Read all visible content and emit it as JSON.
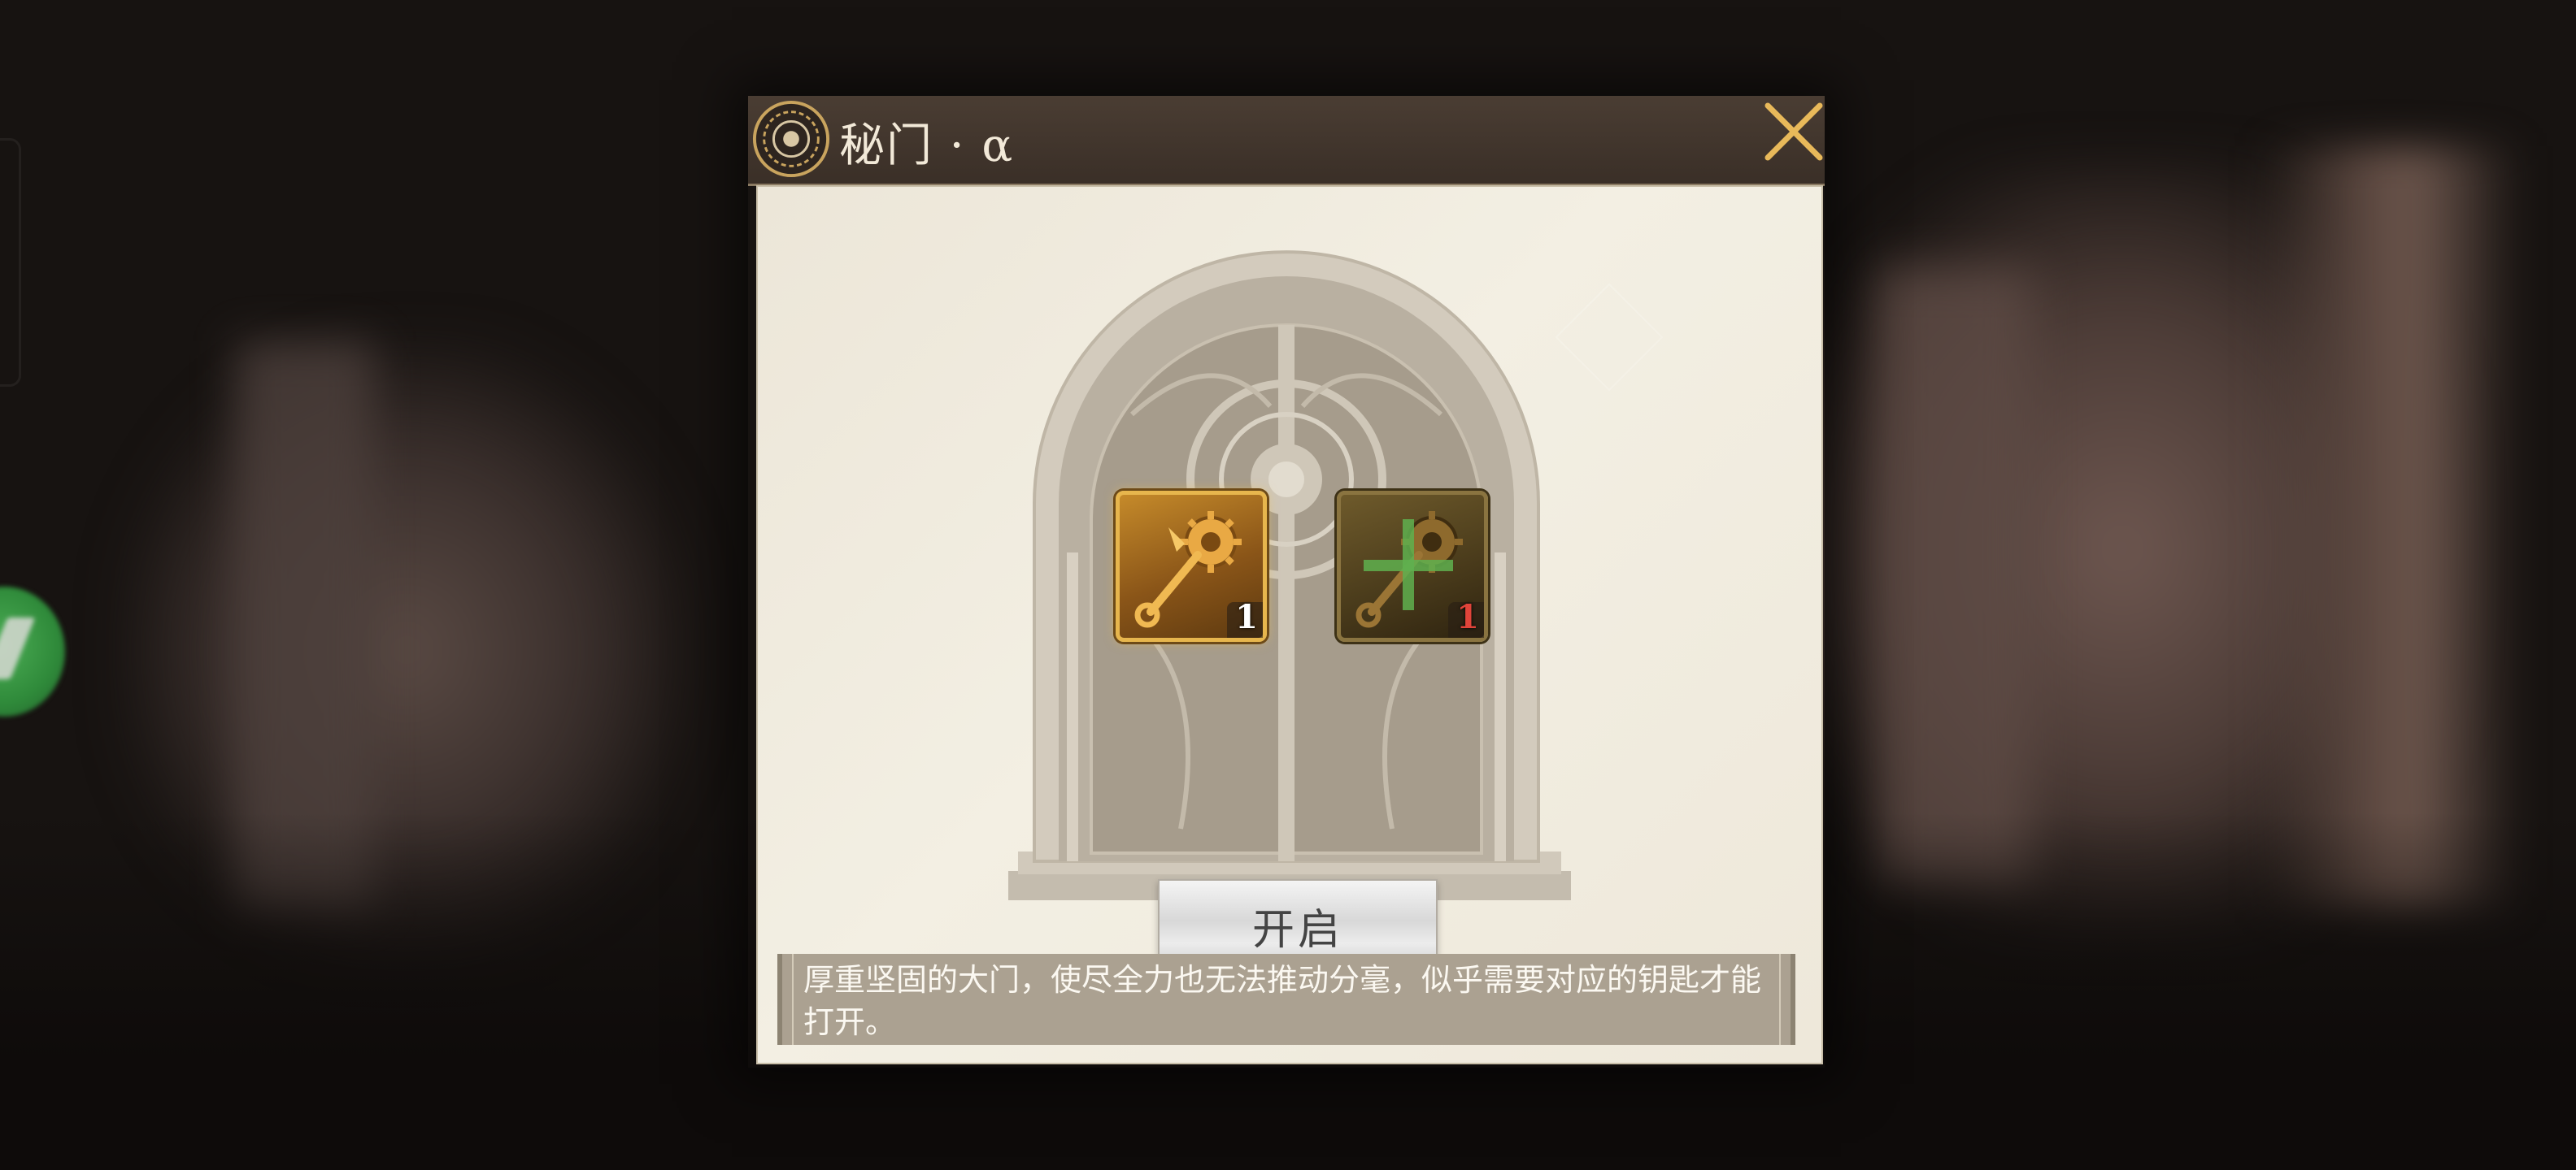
{
  "dialog": {
    "title": "秘门 · α",
    "open_button_label": "开启",
    "description": "厚重坚固的大门，使尽全力也无法推动分毫，似乎需要对应的钥匙才能打开。"
  },
  "keys": [
    {
      "icon": "golden-gear-key-icon",
      "count": "1",
      "state": "available"
    },
    {
      "icon": "locked-gear-key-icon",
      "count": "1",
      "state": "insufficient"
    }
  ],
  "colors": {
    "title_bar": "#3f332a",
    "panel": "#f0ebdf",
    "close": "#e8b95a",
    "count_insufficient": "#e0443a",
    "description_bg": "#aba191"
  }
}
